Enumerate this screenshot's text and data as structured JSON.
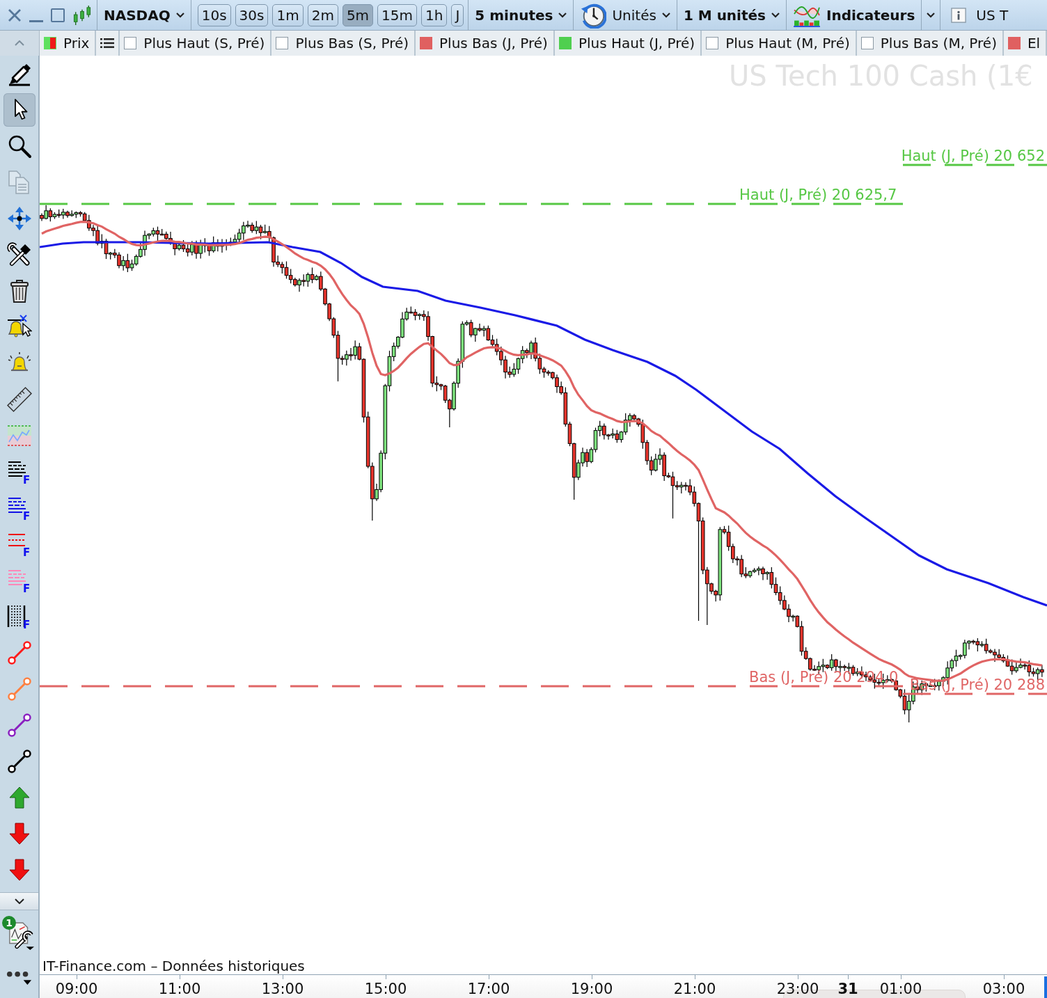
{
  "toolbar": {
    "instrument": "NASDAQ",
    "timeframes": [
      {
        "label": "10s",
        "selected": false
      },
      {
        "label": "30s",
        "selected": false
      },
      {
        "label": "1m",
        "selected": false
      },
      {
        "label": "2m",
        "selected": false
      },
      {
        "label": "5m",
        "selected": true
      },
      {
        "label": "15m",
        "selected": false
      },
      {
        "label": "1h",
        "selected": false
      },
      {
        "label": "J",
        "selected": false
      }
    ],
    "period": "5 minutes",
    "units": "Unités",
    "volume": "1 M unités",
    "indicators": "Indicateurs",
    "info": "US T"
  },
  "legend": {
    "items": [
      {
        "kind": "price",
        "label": "Prix",
        "checked": true
      },
      {
        "kind": "line",
        "label": "Plus Haut (S, Pré)",
        "checked": false
      },
      {
        "kind": "line",
        "label": "Plus Bas (S, Pré)",
        "checked": false
      },
      {
        "kind": "line",
        "label": "Plus Bas (J, Pré)",
        "checked": true,
        "color": "#e06060"
      },
      {
        "kind": "line",
        "label": "Plus Haut (J, Pré)",
        "checked": true,
        "color": "#4fcf4f"
      },
      {
        "kind": "line",
        "label": "Plus Haut (M, Pré)",
        "checked": false
      },
      {
        "kind": "line",
        "label": "Plus Bas (M, Pré)",
        "checked": false
      },
      {
        "kind": "line",
        "label": "El",
        "checked": true,
        "color": "#e06060"
      }
    ]
  },
  "sidebar": {
    "tools": [
      {
        "kind": "pencil",
        "selected": false,
        "disabled": false
      },
      {
        "kind": "pointer",
        "selected": true,
        "disabled": false
      },
      {
        "kind": "zoom",
        "selected": false,
        "disabled": false
      },
      {
        "kind": "copy",
        "selected": false,
        "disabled": true
      },
      {
        "kind": "move",
        "selected": false,
        "disabled": false
      },
      {
        "kind": "tools",
        "selected": false,
        "disabled": false
      },
      {
        "kind": "trash",
        "selected": false,
        "disabled": false
      },
      {
        "kind": "alertcursor",
        "selected": false,
        "disabled": false
      },
      {
        "kind": "alert",
        "selected": false,
        "disabled": false
      },
      {
        "kind": "ruler",
        "selected": false,
        "disabled": false
      },
      {
        "kind": "zone",
        "selected": false,
        "disabled": false
      },
      {
        "kind": "lines",
        "selected": false,
        "disabled": false,
        "color": "#000000",
        "letter": "F"
      },
      {
        "kind": "lines",
        "selected": false,
        "disabled": false,
        "color": "#1414e6",
        "letter": "F"
      },
      {
        "kind": "bands",
        "selected": false,
        "disabled": false,
        "color": "#ee1111",
        "letter": "F"
      },
      {
        "kind": "lines",
        "selected": false,
        "disabled": false,
        "color": "#ff88b8",
        "letter": "F"
      },
      {
        "kind": "verticals",
        "selected": false,
        "disabled": false,
        "letter": "F"
      },
      {
        "kind": "segment",
        "selected": false,
        "disabled": false,
        "color": "#ff1a1a"
      },
      {
        "kind": "segment",
        "selected": false,
        "disabled": false,
        "color": "#ff7f3f"
      },
      {
        "kind": "segment",
        "selected": false,
        "disabled": false,
        "color": "#8a1fc0"
      },
      {
        "kind": "segment",
        "selected": false,
        "disabled": false,
        "color": "#000000"
      },
      {
        "kind": "up",
        "selected": false,
        "disabled": false
      },
      {
        "kind": "down",
        "selected": false,
        "disabled": false
      },
      {
        "kind": "down",
        "selected": false,
        "disabled": false
      }
    ],
    "settings_badge": "1"
  },
  "chart": {
    "title": "US Tech 100 Cash (1€",
    "levels": [
      {
        "kind": "high",
        "label": "Haut (J, Pré) 20 652"
      },
      {
        "kind": "high",
        "label": "Haut (J, Pré) 20 625,7"
      },
      {
        "kind": "low",
        "label": "Bas (J, Pré) 20 294,0"
      },
      {
        "kind": "low",
        "label": "Bas (J, Pré) 20 288"
      }
    ],
    "source": "IT-Finance.com – Données historiques"
  },
  "time_axis": {
    "labels": [
      {
        "kind": "time",
        "text": "09:00"
      },
      {
        "kind": "time",
        "text": "11:00"
      },
      {
        "kind": "time",
        "text": "13:00"
      },
      {
        "kind": "time",
        "text": "15:00"
      },
      {
        "kind": "time",
        "text": "17:00"
      },
      {
        "kind": "time",
        "text": "19:00"
      },
      {
        "kind": "time",
        "text": "21:00"
      },
      {
        "kind": "time",
        "text": "23:00"
      },
      {
        "kind": "date",
        "text": "31"
      },
      {
        "kind": "time",
        "text": "01:00"
      },
      {
        "kind": "time",
        "text": "03:00"
      }
    ]
  }
}
